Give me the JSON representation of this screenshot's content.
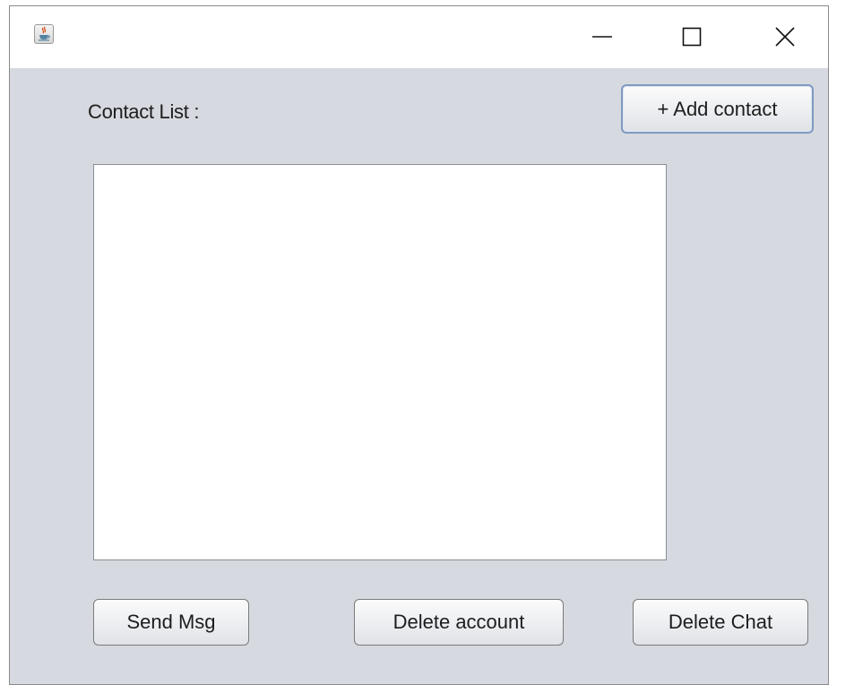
{
  "window": {
    "icon": "java-cup-icon",
    "controls": {
      "minimize_icon": "minimize-icon",
      "maximize_icon": "maximize-icon",
      "close_icon": "close-icon"
    }
  },
  "main": {
    "contact_list_label": "Contact List :",
    "add_contact_label": "+ Add contact",
    "contacts": [],
    "buttons": {
      "send_msg": "Send Msg",
      "delete_account": "Delete account",
      "delete_chat": "Delete Chat"
    }
  },
  "colors": {
    "panel_background": "#d6d9df",
    "list_background": "#ffffff",
    "focus_border": "#7f99c1"
  }
}
